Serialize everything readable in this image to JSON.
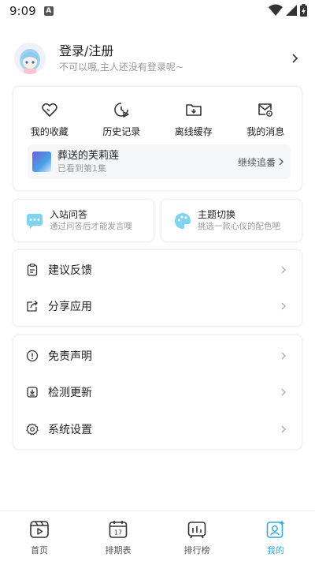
{
  "status": {
    "time": "9:09",
    "notif_badge": "A"
  },
  "profile": {
    "title": "登录/注册",
    "subtitle": "不可以哦,主人还没有登录呢~"
  },
  "quick": [
    {
      "label": "我的收藏",
      "icon": "heart-icon"
    },
    {
      "label": "历史记录",
      "icon": "history-icon"
    },
    {
      "label": "离线缓存",
      "icon": "folder-download-icon"
    },
    {
      "label": "我的消息",
      "icon": "mail-icon"
    }
  ],
  "resume": {
    "title": "葬送的芙莉莲",
    "progress": "已看到第1集",
    "action": "继续追番"
  },
  "qa": {
    "title": "入站问答",
    "subtitle": "通过问答后才能发言噢"
  },
  "theme": {
    "title": "主题切换",
    "subtitle": "挑选一款心仪的配色吧"
  },
  "menu1": [
    {
      "label": "建议反馈"
    },
    {
      "label": "分享应用"
    }
  ],
  "menu2": [
    {
      "label": "免责声明"
    },
    {
      "label": "检测更新"
    },
    {
      "label": "系统设置"
    }
  ],
  "nav": [
    {
      "label": "首页"
    },
    {
      "label": "排期表",
      "calendar_day": "17"
    },
    {
      "label": "排行榜"
    },
    {
      "label": "我的",
      "active": true
    }
  ],
  "colors": {
    "accent": "#39a8dd",
    "qa_icon": "#7fd3ef",
    "theme_icon": "#7fd3ef"
  }
}
